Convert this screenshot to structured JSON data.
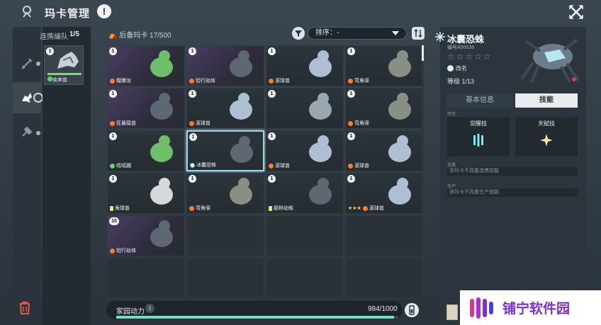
{
  "header": {
    "title": "玛卡管理",
    "alert": "!"
  },
  "team": {
    "label": "连携编队",
    "count": "1/5",
    "card": {
      "level": "1",
      "name": "疾奔兽",
      "element": "grass"
    }
  },
  "reserve": {
    "label": "后备玛卡",
    "count": "17/500"
  },
  "sort": {
    "label": "排序：-"
  },
  "cards": [
    {
      "level": "1",
      "name": "榴爆龙",
      "element": "fire",
      "style": "purple"
    },
    {
      "level": "1",
      "name": "钽行劫体",
      "element": "fire",
      "style": "purple"
    },
    {
      "level": "1",
      "name": "滚球兽",
      "element": "fire",
      "style": "normal"
    },
    {
      "level": "1",
      "name": "弯角驿",
      "element": "fire",
      "style": "normal"
    },
    {
      "level": "1",
      "name": "狂暴猿兽",
      "element": "fire",
      "style": "purple"
    },
    {
      "level": "1",
      "name": "滚球兽",
      "element": "fire",
      "style": "normal"
    },
    {
      "level": "1",
      "name": "",
      "element": "",
      "style": "normal"
    },
    {
      "level": "1",
      "name": "弯角驿",
      "element": "fire",
      "style": "normal"
    },
    {
      "level": "1",
      "name": "呱呱蹦",
      "element": "grass",
      "style": "normal"
    },
    {
      "level": "1",
      "name": "冰囊恐蛛",
      "element": "ice",
      "style": "selected"
    },
    {
      "level": "1",
      "name": "滚球兽",
      "element": "fire",
      "style": "normal"
    },
    {
      "level": "1",
      "name": "滚球兽",
      "element": "fire",
      "style": "normal"
    },
    {
      "level": "1",
      "name": "角球兽",
      "element": "bolt",
      "style": "normal"
    },
    {
      "level": "1",
      "name": "弯角驿",
      "element": "fire",
      "style": "normal"
    },
    {
      "level": "1",
      "name": "掘林劫蛛",
      "element": "bolt",
      "style": "normal"
    },
    {
      "level": "1",
      "name": "滚球兽",
      "element": "fire",
      "style": "normal",
      "stars": "★★★"
    },
    {
      "level": "10",
      "name": "钽行劫体",
      "element": "fire",
      "style": "purple"
    }
  ],
  "power": {
    "label": "家园动力",
    "value": "984/1000",
    "fraction": 0.984
  },
  "detail": {
    "name": "冰囊恐蛛",
    "id": "编号A00036",
    "stars": "☆☆☆☆☆",
    "rename": "改名",
    "level": "等级 1/13",
    "tabs": {
      "basic": "基本信息",
      "skill": "技能"
    },
    "trait_label": "特性",
    "awaken": "觉醒技",
    "talent": "天赋技",
    "link_label": "连携",
    "link_text": "该玛卡不具备连携技能",
    "prod_label": "生产",
    "prod_text": "该玛卡不具备生产技能"
  },
  "watermark": "铺宁软件园"
}
